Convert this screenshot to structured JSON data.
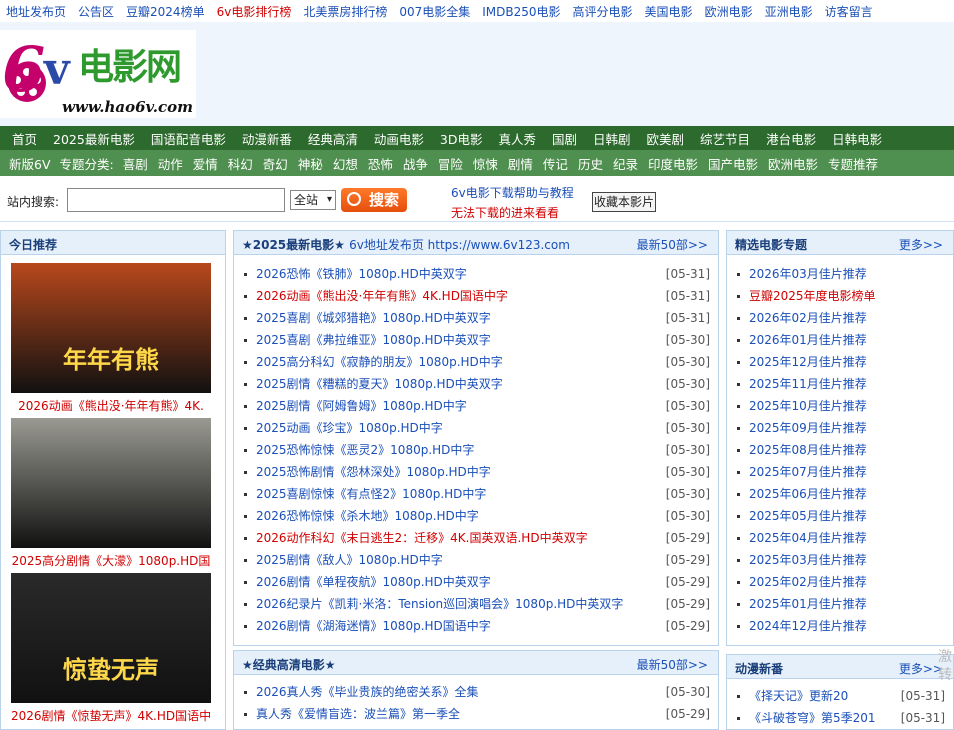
{
  "top_links": [
    {
      "label": "地址发布页",
      "red": false
    },
    {
      "label": "公告区",
      "red": false
    },
    {
      "label": "豆瓣2024榜单",
      "red": false
    },
    {
      "label": "6v电影排行榜",
      "red": true
    },
    {
      "label": "北美票房排行榜",
      "red": false
    },
    {
      "label": "007电影全集",
      "red": false
    },
    {
      "label": "IMDB250电影",
      "red": false
    },
    {
      "label": "高评分电影",
      "red": false
    },
    {
      "label": "美国电影",
      "red": false
    },
    {
      "label": "欧洲电影",
      "red": false
    },
    {
      "label": "亚洲电影",
      "red": false
    },
    {
      "label": "访客留言",
      "red": false
    }
  ],
  "logo": {
    "mark": "6",
    "v": "v",
    "cn": "电影网",
    "url": "www.hao6v.com"
  },
  "nav_main": [
    "首页",
    "2025最新电影",
    "国语配音电影",
    "动漫新番",
    "经典高清",
    "动画电影",
    "3D电影",
    "真人秀",
    "国剧",
    "日韩剧",
    "欧美剧",
    "综艺节目",
    "港台电影",
    "日韩电影"
  ],
  "nav_sub_label": "新版6V",
  "nav_sub_cat": "专题分类:",
  "nav_sub": [
    "喜剧",
    "动作",
    "爱情",
    "科幻",
    "奇幻",
    "神秘",
    "幻想",
    "恐怖",
    "战争",
    "冒险",
    "惊悚",
    "剧情",
    "传记",
    "历史",
    "纪录",
    "印度电影",
    "国产电影",
    "欧洲电影",
    "专题推荐"
  ],
  "search": {
    "label": "站内搜索:",
    "value": "",
    "scope": "全站",
    "button": "搜索",
    "help": "6v电影下载帮助与教程",
    "help2": "无法下载的进来看看",
    "fav": "收藏本影片"
  },
  "today": {
    "title": "今日推荐",
    "posters": [
      {
        "caption": "2026动画《熊出没·年年有熊》4K.",
        "poster_title": "年年有熊",
        "bg": "#b8481c"
      },
      {
        "caption": "2025高分剧情《大濛》1080p.HD国",
        "poster_title": "",
        "bg": "#9a9a92"
      },
      {
        "caption": "2026剧情《惊蛰无声》4K.HD国语中",
        "poster_title": "惊蛰无声",
        "bg": "#2a2a2a"
      }
    ]
  },
  "latest": {
    "title": "★2025最新电影★",
    "subtitle": "6v地址发布页 https://www.6v123.com",
    "more": "最新50部>>",
    "items": [
      {
        "text": "2026恐怖《铁肺》1080p.HD中英双字",
        "date": "[05-31]",
        "red": false
      },
      {
        "text": "2026动画《熊出没·年年有熊》4K.HD国语中字",
        "date": "[05-31]",
        "red": true
      },
      {
        "text": "2025喜剧《城郊猎艳》1080p.HD中英双字",
        "date": "[05-31]",
        "red": false
      },
      {
        "text": "2025喜剧《弗拉维亚》1080p.HD中英双字",
        "date": "[05-30]",
        "red": false
      },
      {
        "text": "2025高分科幻《寂静的朋友》1080p.HD中字",
        "date": "[05-30]",
        "red": false
      },
      {
        "text": "2025剧情《糟糕的夏天》1080p.HD中英双字",
        "date": "[05-30]",
        "red": false
      },
      {
        "text": "2025剧情《阿姆鲁姆》1080p.HD中字",
        "date": "[05-30]",
        "red": false
      },
      {
        "text": "2025动画《珍宝》1080p.HD中字",
        "date": "[05-30]",
        "red": false
      },
      {
        "text": "2025恐怖惊悚《恶灵2》1080p.HD中字",
        "date": "[05-30]",
        "red": false
      },
      {
        "text": "2025恐怖剧情《怨林深处》1080p.HD中字",
        "date": "[05-30]",
        "red": false
      },
      {
        "text": "2025喜剧惊悚《有点怪2》1080p.HD中字",
        "date": "[05-30]",
        "red": false
      },
      {
        "text": "2026恐怖惊悚《杀木地》1080p.HD中字",
        "date": "[05-30]",
        "red": false
      },
      {
        "text": "2026动作科幻《末日逃生2：迁移》4K.国英双语.HD中英双字",
        "date": "[05-29]",
        "red": true
      },
      {
        "text": "2025剧情《敌人》1080p.HD中字",
        "date": "[05-29]",
        "red": false
      },
      {
        "text": "2026剧情《单程夜航》1080p.HD中英双字",
        "date": "[05-29]",
        "red": false
      },
      {
        "text": "2026纪录片《凯莉·米洛：Tension巡回演唱会》1080p.HD中英双字",
        "date": "[05-29]",
        "red": false
      },
      {
        "text": "2026剧情《湖海迷情》1080p.HD国语中字",
        "date": "[05-29]",
        "red": false
      }
    ]
  },
  "classic": {
    "title": "★经典高清电影★",
    "more": "最新50部>>",
    "items": [
      {
        "text": "2026真人秀《毕业贵族的绝密关系》全集",
        "date": "[05-30]",
        "red": false
      },
      {
        "text": "真人秀《爱情盲选：波兰篇》第一季全",
        "date": "[05-29]",
        "red": false
      }
    ]
  },
  "topics": {
    "title": "精选电影专题",
    "more": "更多>>",
    "items": [
      {
        "text": "2026年03月佳片推荐",
        "red": false
      },
      {
        "text": "豆瓣2025年度电影榜单",
        "red": true
      },
      {
        "text": "2026年02月佳片推荐",
        "red": false
      },
      {
        "text": "2026年01月佳片推荐",
        "red": false
      },
      {
        "text": "2025年12月佳片推荐",
        "red": false
      },
      {
        "text": "2025年11月佳片推荐",
        "red": false
      },
      {
        "text": "2025年10月佳片推荐",
        "red": false
      },
      {
        "text": "2025年09月佳片推荐",
        "red": false
      },
      {
        "text": "2025年08月佳片推荐",
        "red": false
      },
      {
        "text": "2025年07月佳片推荐",
        "red": false
      },
      {
        "text": "2025年06月佳片推荐",
        "red": false
      },
      {
        "text": "2025年05月佳片推荐",
        "red": false
      },
      {
        "text": "2025年04月佳片推荐",
        "red": false
      },
      {
        "text": "2025年03月佳片推荐",
        "red": false
      },
      {
        "text": "2025年02月佳片推荐",
        "red": false
      },
      {
        "text": "2025年01月佳片推荐",
        "red": false
      },
      {
        "text": "2024年12月佳片推荐",
        "red": false
      }
    ]
  },
  "anime": {
    "title": "动漫新番",
    "more": "更多>>",
    "items": [
      {
        "text": "《择天记》更新20",
        "date": "[05-31]"
      },
      {
        "text": "《斗破苍穹》第5季201",
        "date": "[05-31]"
      }
    ]
  },
  "float_text": [
    "激",
    "转"
  ]
}
